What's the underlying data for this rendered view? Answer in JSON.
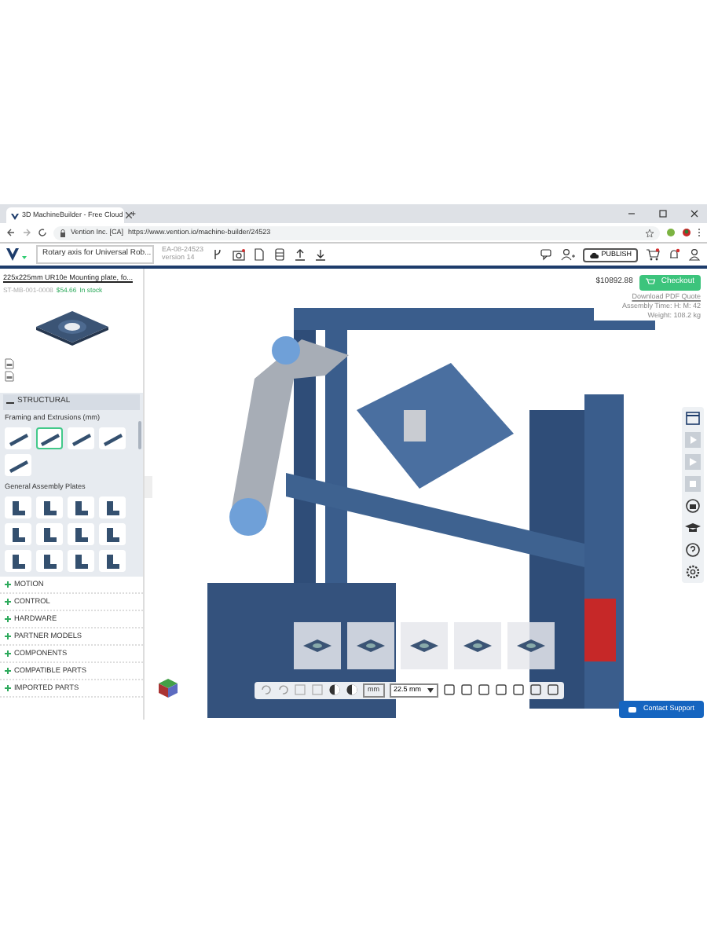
{
  "browser": {
    "tab_title": "3D MachineBuilder - Free Cloud",
    "new_tab": "+",
    "site": "Vention Inc. [CA]",
    "url": "https://www.vention.io/machine-builder/24523"
  },
  "toolbar": {
    "project_name": "Rotary axis for Universal Rob...",
    "design_id": "EA-08-24523",
    "version": "version 14",
    "publish": "PUBLISH"
  },
  "part": {
    "title": "225x225mm UR10e Mounting plate, fo...",
    "sku": "ST-MB-001-0008",
    "price": "$54.66",
    "stock": "In stock"
  },
  "summary": {
    "total": "$10892.88",
    "checkout": "Checkout",
    "quote": "Download PDF Quote",
    "assembly_time": "Assembly Time: H: M: 42",
    "weight": "Weight: 108.2 kg"
  },
  "library": {
    "section": "STRUCTURAL",
    "expanded": true,
    "groups": [
      {
        "title": "Framing and Extrusions (mm)",
        "kind": "extrusion",
        "items": [
          {
            "selected": false
          },
          {
            "selected": true
          },
          {
            "selected": false
          },
          {
            "selected": false
          },
          {
            "selected": false
          }
        ]
      },
      {
        "title": "General Assembly Plates",
        "kind": "plate",
        "items": [
          {
            "selected": false
          },
          {
            "selected": false
          },
          {
            "selected": false
          },
          {
            "selected": false
          },
          {
            "selected": false
          },
          {
            "selected": false
          },
          {
            "selected": false
          },
          {
            "selected": false
          },
          {
            "selected": false
          },
          {
            "selected": false
          },
          {
            "selected": false
          },
          {
            "selected": false
          }
        ]
      }
    ]
  },
  "categories": [
    "MOTION",
    "CONTROL",
    "HARDWARE",
    "PARTNER MODELS",
    "COMPONENTS",
    "COMPATIBLE PARTS",
    "IMPORTED PARTS"
  ],
  "bottom_toolbar": {
    "unit": "mm",
    "snap": "22.5 mm"
  },
  "support": "Contact Support"
}
